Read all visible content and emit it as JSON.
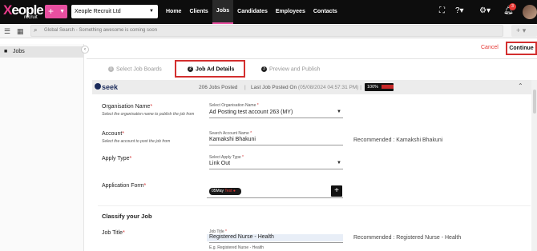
{
  "header": {
    "logo_letter": "X",
    "logo_text": "eople",
    "logo_sub": "recruit",
    "plus": "+",
    "company": "Xeople Recruit Ltd",
    "nav": [
      "Home",
      "Clients",
      "Jobs",
      "Candidates",
      "Employees",
      "Contacts"
    ],
    "active_nav": "Jobs",
    "notifications": "3",
    "accent": "#e84fa0"
  },
  "search": {
    "placeholder": "Global Search - Something awesome is coming soon",
    "plus": "+"
  },
  "sidebar": {
    "items": [
      {
        "label": "Jobs",
        "icon": "briefcase-icon"
      }
    ]
  },
  "actions": {
    "cancel": "Cancel",
    "continue": "Continue"
  },
  "steps": [
    {
      "num": "1",
      "label": "Select Job Boards"
    },
    {
      "num": "2",
      "label": "Job Ad Details"
    },
    {
      "num": "3",
      "label": "Preview and Publish"
    }
  ],
  "panel": {
    "board": "seek",
    "jobs_posted": "206 Jobs Posted",
    "last_posted": "Last Job Posted On",
    "last_posted_date": "(05/08/2024 04:57:31 PM)",
    "pct": "100%"
  },
  "form": {
    "org_label": "Organisation Name",
    "org_hint": "Select the organisation name to publish the job from",
    "org_field_label": "Select Organisation Name",
    "org_value": "Ad Posting test account 263 (MY)",
    "account_label": "Account",
    "account_hint": "Select the account to post the job from",
    "account_field_label": "Search Account Name",
    "account_value": "Kamakshi Bhakuni",
    "account_rec": "Recommended : Kamakshi Bhakuni",
    "apply_label": "Apply Type",
    "apply_field_label": "Select Apply Type",
    "apply_value": "Link Out",
    "appform_label": "Application Form",
    "appform_chip_a": "05May",
    "appform_chip_b": "Test",
    "section": "Classify your Job",
    "jobtitle_label": "Job Title",
    "jobtitle_field_label": "Job Title",
    "jobtitle_value": "Registered Nurse - Health",
    "jobtitle_hint": "E.g. Registered Nurse - Health",
    "jobtitle_rec": "Recommended : Registered Nurse - Health",
    "required": "*"
  }
}
